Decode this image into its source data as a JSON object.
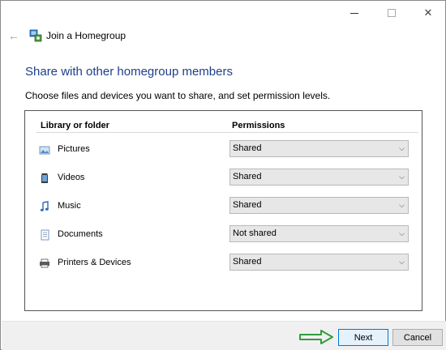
{
  "window": {
    "controls": {
      "minimize": "—",
      "maximize": "☐",
      "close": "✕"
    }
  },
  "header": {
    "back_icon": "back-arrow-icon",
    "title": "Join a Homegroup"
  },
  "main": {
    "heading": "Share with other homegroup members",
    "instruction": "Choose files and devices you want to share, and set permission levels.",
    "columns": {
      "library": "Library or folder",
      "permissions": "Permissions"
    },
    "rows": [
      {
        "label": "Pictures",
        "icon": "pictures-icon",
        "permission": "Shared"
      },
      {
        "label": "Videos",
        "icon": "videos-icon",
        "permission": "Shared"
      },
      {
        "label": "Music",
        "icon": "music-icon",
        "permission": "Shared"
      },
      {
        "label": "Documents",
        "icon": "documents-icon",
        "permission": "Not shared"
      },
      {
        "label": "Printers & Devices",
        "icon": "printer-icon",
        "permission": "Shared"
      }
    ]
  },
  "footer": {
    "next_label": "Next",
    "cancel_label": "Cancel",
    "annotation_arrow_color": "#2e9e3e"
  },
  "colors": {
    "heading": "#1e3f8a",
    "footer_bg": "#f0f0f0",
    "primary_button_border": "#0078d7"
  }
}
